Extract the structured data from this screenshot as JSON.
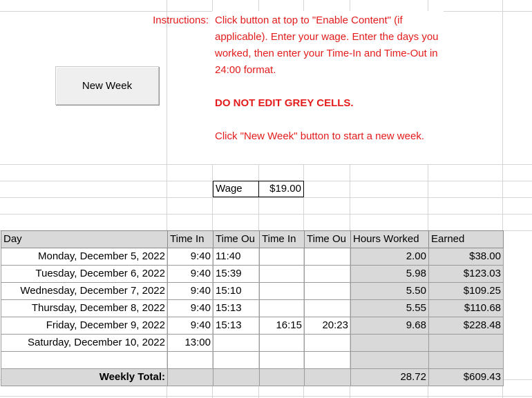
{
  "instructions": {
    "label": "Instructions:",
    "body": "Click button at top to \"Enable Content\" (if applicable). Enter your wage. Enter the days you worked, then enter your Time-In and Time-Out in 24:00 format.",
    "warning": "DO NOT EDIT GREY CELLS.",
    "new_week_note": "Click \"New Week\" button to start a new week."
  },
  "new_week_button": {
    "label": "New Week"
  },
  "wage": {
    "label": "Wage",
    "value": "$19.00"
  },
  "timesheet": {
    "headers": [
      "Day",
      "Time In",
      "Time Ou",
      "Time In",
      "Time Ou",
      "Hours Worked",
      "Earned"
    ],
    "rows": [
      [
        "Monday, December 5, 2022",
        "9:40",
        "11:40",
        "",
        "",
        "2.00",
        "$38.00"
      ],
      [
        "Tuesday, December 6, 2022",
        "9:40",
        "15:39",
        "",
        "",
        "5.98",
        "$123.03"
      ],
      [
        "Wednesday, December 7, 2022",
        "9:40",
        "15:10",
        "",
        "",
        "5.50",
        "$109.25"
      ],
      [
        "Thursday, December 8, 2022",
        "9:40",
        "15:13",
        "",
        "",
        "5.55",
        "$110.68"
      ],
      [
        "Friday, December 9, 2022",
        "9:40",
        "15:13",
        "16:15",
        "20:23",
        "9.68",
        "$228.48"
      ],
      [
        "Saturday, December 10, 2022",
        "13:00",
        "",
        "",
        "",
        "",
        ""
      ],
      [
        "",
        "",
        "",
        "",
        "",
        "",
        ""
      ]
    ],
    "total": {
      "label": "Weekly Total:",
      "hours": "28.72",
      "earned": "$609.43"
    }
  },
  "colors": {
    "instruction_text": "#e41b1b",
    "grey_cell": "#d9d9d9",
    "gridline": "#d4d4d4"
  }
}
